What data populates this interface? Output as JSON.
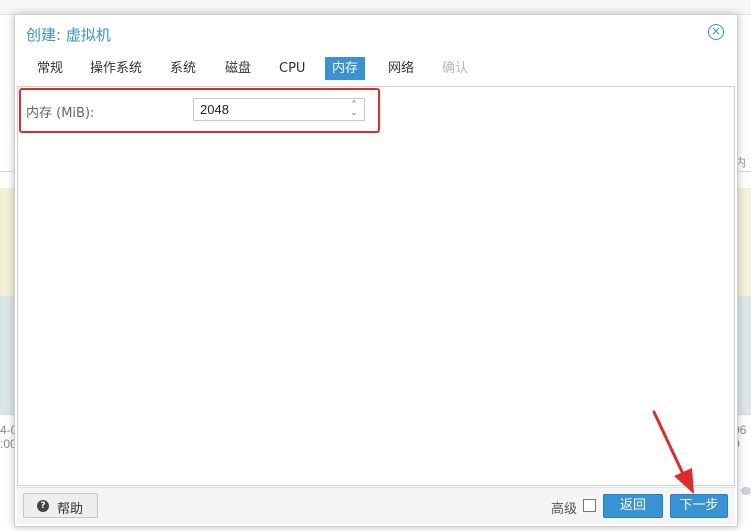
{
  "dialog": {
    "title": "创建: 虚拟机",
    "close_icon": "×"
  },
  "tabs": [
    {
      "label": "常规",
      "state": "normal"
    },
    {
      "label": "操作系统",
      "state": "normal"
    },
    {
      "label": "系统",
      "state": "normal"
    },
    {
      "label": "磁盘",
      "state": "normal"
    },
    {
      "label": "CPU",
      "state": "normal"
    },
    {
      "label": "内存",
      "state": "active"
    },
    {
      "label": "网络",
      "state": "normal"
    },
    {
      "label": "确认",
      "state": "disabled"
    }
  ],
  "memory": {
    "label": "内存 (MiB):",
    "value": "2048",
    "spinner_glyph": "⌃⌄"
  },
  "footer": {
    "help_label": "帮助",
    "help_icon": "?",
    "advanced_label": "高级",
    "advanced_checked": false,
    "back_label": "返回",
    "next_label": "下一步"
  },
  "background": {
    "left_edge_text": "4-0\n:00",
    "right_edge_text": "06\n0",
    "right_label": "内"
  },
  "colors": {
    "accent": "#3892d4",
    "annotation": "#e12b2b"
  }
}
